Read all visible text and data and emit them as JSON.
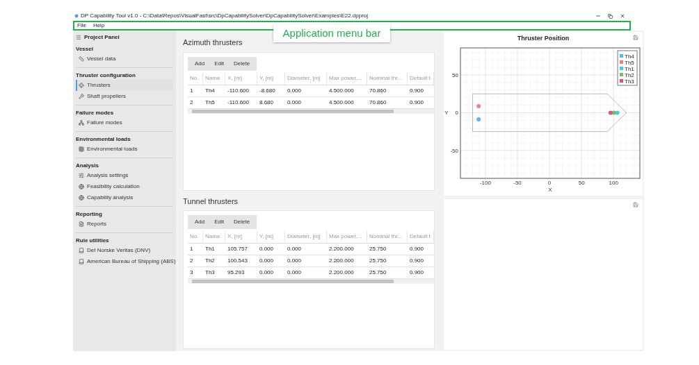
{
  "window": {
    "title": "DP Capability Tool v1.0 - C:\\Data\\Repos\\VisualFast\\src\\DpCapabilitySolver\\DpCapabilitySolver\\Examples\\E22.dpproj"
  },
  "menu": [
    "File",
    "Help"
  ],
  "callout": {
    "text": "Application menu bar"
  },
  "sidebar": {
    "title": "Project Panel",
    "sections": [
      {
        "heading": "Vessel",
        "items": [
          {
            "label": "Vessel data",
            "kind": "ruler",
            "selected": false
          }
        ]
      },
      {
        "heading": "Thruster configuration",
        "items": [
          {
            "label": "Thrusters",
            "kind": "thruster",
            "selected": true
          },
          {
            "label": "Shaft propellers",
            "kind": "propeller",
            "selected": false
          }
        ]
      },
      {
        "heading": "Failure modes",
        "items": [
          {
            "label": "Failure modes",
            "kind": "network",
            "selected": false
          }
        ]
      },
      {
        "heading": "Environmental loads",
        "items": [
          {
            "label": "Environmental loads",
            "kind": "grid",
            "selected": false
          }
        ]
      },
      {
        "heading": "Analysis",
        "items": [
          {
            "label": "Analysis settings",
            "kind": "sliders",
            "selected": false
          },
          {
            "label": "Feasibility calculation",
            "kind": "globe",
            "selected": false
          },
          {
            "label": "Capability analysis",
            "kind": "globe",
            "selected": false
          }
        ]
      },
      {
        "heading": "Reporting",
        "items": [
          {
            "label": "Reports",
            "kind": "file",
            "selected": false
          }
        ]
      },
      {
        "heading": "Rule utilities",
        "items": [
          {
            "label": "Det Norske Veritas (DNV)",
            "kind": "book",
            "selected": false
          },
          {
            "label": "American Bureau of Shipping (ABS)",
            "kind": "book",
            "selected": false
          }
        ]
      }
    ]
  },
  "tables": [
    {
      "title": "Azimuth thrusters",
      "buttons": [
        "Add",
        "Edit",
        "Delete"
      ],
      "columns": [
        "No.",
        "Name",
        "X, [m]",
        "Y, [m]",
        "Diameter, [m]",
        "Max power,...",
        "Nominal thr...",
        "Default t"
      ],
      "rows": [
        [
          "1",
          "Th4",
          "-110.600",
          "-8.680",
          "0.000",
          "4.500.000",
          "70.860",
          "0.900"
        ],
        [
          "2",
          "Th5",
          "-110.600",
          "8.680",
          "0.000",
          "4.500.000",
          "70.860",
          "0.900"
        ]
      ]
    },
    {
      "title": "Tunnel thrusters",
      "buttons": [
        "Add",
        "Edit",
        "Delete"
      ],
      "columns": [
        "No.",
        "Name",
        "X, [m]",
        "Y, [m]",
        "Diameter, [m]",
        "Max power,...",
        "Nominal thr...",
        "Default t"
      ],
      "rows": [
        [
          "1",
          "Th1",
          "105.757",
          "0.000",
          "0.000",
          "2.200.000",
          "25.750",
          "0.900"
        ],
        [
          "2",
          "Th2",
          "100.543",
          "0.000",
          "0.000",
          "2.200.000",
          "25.750",
          "0.900"
        ],
        [
          "3",
          "Th3",
          "95.293",
          "0.000",
          "0.000",
          "2.200.000",
          "25.750",
          "0.900"
        ]
      ]
    }
  ],
  "plot": {
    "chart_data": {
      "type": "scatter",
      "title": "Thruster Position",
      "xlabel": "X",
      "ylabel": "Y",
      "xlim": [
        -139,
        141
      ],
      "ylim": [
        -87,
        86
      ],
      "xticks": [
        -100,
        -50,
        0,
        50,
        100
      ],
      "yticks": [
        -50,
        0,
        50
      ],
      "grid": true,
      "legend": "upper right",
      "series": [
        {
          "name": "Th4",
          "color": "#5ab4f0",
          "x": [
            -110.6
          ],
          "values": [
            -8.68
          ]
        },
        {
          "name": "Th5",
          "color": "#f08080",
          "x": [
            -110.6
          ],
          "values": [
            8.68
          ]
        },
        {
          "name": "Th1",
          "color": "#40ccd6",
          "x": [
            105.757
          ],
          "values": [
            0
          ]
        },
        {
          "name": "Th2",
          "color": "#6cc070",
          "x": [
            100.543
          ],
          "values": [
            0
          ]
        },
        {
          "name": "Th3",
          "color": "#e0507a",
          "x": [
            95.293
          ],
          "values": [
            0
          ]
        }
      ]
    }
  }
}
